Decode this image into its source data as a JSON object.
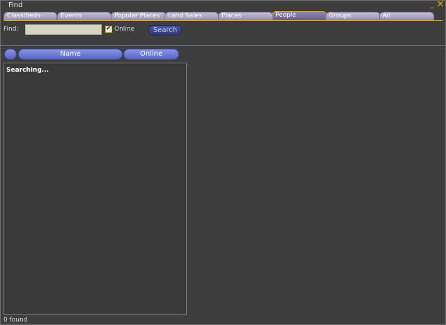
{
  "window": {
    "title": "Find"
  },
  "icons": {
    "minimize": "_",
    "close": "✕",
    "check": "✔"
  },
  "tabs": [
    {
      "label": "Classifieds"
    },
    {
      "label": "Events"
    },
    {
      "label": "Popular Places"
    },
    {
      "label": "Land Sales"
    },
    {
      "label": "Places"
    },
    {
      "label": "People"
    },
    {
      "label": "Groups"
    },
    {
      "label": "All"
    }
  ],
  "active_tab": "People",
  "search": {
    "label": "Find:",
    "value": "",
    "online_label": "Online",
    "online_checked": true,
    "button_label": "Search"
  },
  "results": {
    "columns": [
      {
        "label": ""
      },
      {
        "label": "Name"
      },
      {
        "label": "Online"
      }
    ],
    "items": [
      "Searching..."
    ]
  },
  "status": {
    "text": "0 found"
  },
  "colors": {
    "accent": "#e8a800",
    "background": "#3e3e3e",
    "header": "#6a76d4",
    "search_button": "#3a448a"
  }
}
